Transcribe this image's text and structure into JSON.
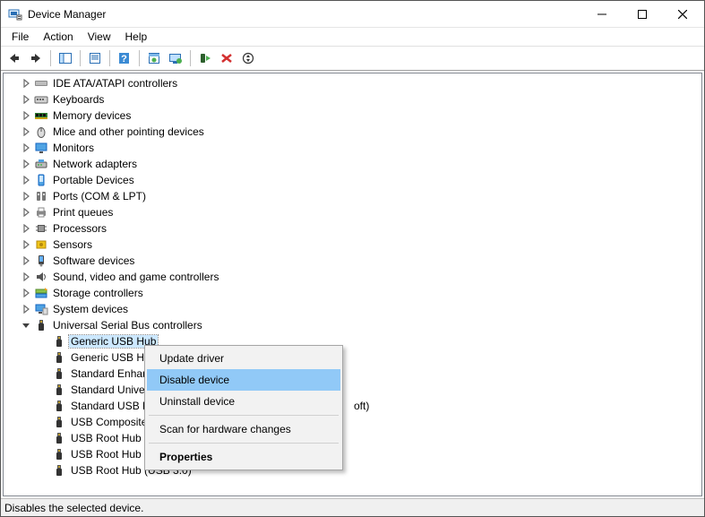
{
  "window": {
    "title": "Device Manager"
  },
  "menubar": {
    "items": [
      "File",
      "Action",
      "View",
      "Help"
    ]
  },
  "toolbar": {
    "buttons": [
      "back",
      "forward",
      "|",
      "show-hidden",
      "|",
      "properties",
      "|",
      "help",
      "|",
      "update",
      "monitor",
      "|",
      "enable",
      "delete",
      "scan"
    ]
  },
  "tree": {
    "categories": [
      {
        "label": "IDE ATA/ATAPI controllers",
        "icon": "ide"
      },
      {
        "label": "Keyboards",
        "icon": "keyboard"
      },
      {
        "label": "Memory devices",
        "icon": "memory"
      },
      {
        "label": "Mice and other pointing devices",
        "icon": "mouse"
      },
      {
        "label": "Monitors",
        "icon": "monitor"
      },
      {
        "label": "Network adapters",
        "icon": "network"
      },
      {
        "label": "Portable Devices",
        "icon": "portable"
      },
      {
        "label": "Ports (COM & LPT)",
        "icon": "ports"
      },
      {
        "label": "Print queues",
        "icon": "printer"
      },
      {
        "label": "Processors",
        "icon": "cpu"
      },
      {
        "label": "Sensors",
        "icon": "sensor"
      },
      {
        "label": "Software devices",
        "icon": "software"
      },
      {
        "label": "Sound, video and game controllers",
        "icon": "sound"
      },
      {
        "label": "Storage controllers",
        "icon": "storage"
      },
      {
        "label": "System devices",
        "icon": "system"
      }
    ],
    "expanded": {
      "label": "Universal Serial Bus controllers",
      "icon": "usb-controller",
      "children": [
        {
          "label": "Generic USB Hub",
          "selected": true
        },
        {
          "label": "Generic USB Hub"
        },
        {
          "label": "Standard Enhanced PCI to USB Host Controller",
          "truncated_suffix": ""
        },
        {
          "label": "Standard Universal PCI to USB Host Controller"
        },
        {
          "label": "Standard USB Host Controller",
          "truncated_tail": "oft)"
        },
        {
          "label": "USB Composite Device"
        },
        {
          "label": "USB Root Hub"
        },
        {
          "label": "USB Root Hub"
        },
        {
          "label": "USB Root Hub (USB 3.0)"
        }
      ]
    }
  },
  "context_menu": {
    "items": [
      {
        "label": "Update driver"
      },
      {
        "label": "Disable device",
        "highlight": true
      },
      {
        "label": "Uninstall device"
      },
      {
        "sep": true
      },
      {
        "label": "Scan for hardware changes"
      },
      {
        "sep": true
      },
      {
        "label": "Properties",
        "bold": true
      }
    ]
  },
  "status": {
    "text": "Disables the selected device."
  }
}
